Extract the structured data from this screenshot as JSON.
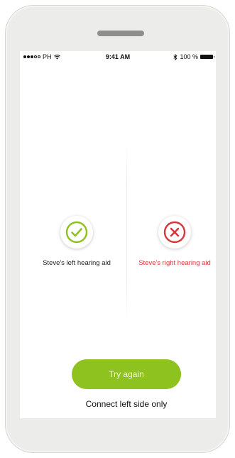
{
  "status_bar": {
    "carrier": "PH",
    "time": "9:41 AM",
    "battery": "100 %"
  },
  "left_aid": {
    "label": "Steve's left hearing aid",
    "state": "connected",
    "icon": "checkmark-icon",
    "color": "#8dc21f"
  },
  "right_aid": {
    "label": "Steve's right hearing aid",
    "state": "failed",
    "icon": "x-icon",
    "color": "#d6373d"
  },
  "actions": {
    "try_again": "Try again",
    "connect_left_only": "Connect left side only"
  },
  "colors": {
    "accent": "#8dc21f",
    "error": "#d6373d"
  }
}
